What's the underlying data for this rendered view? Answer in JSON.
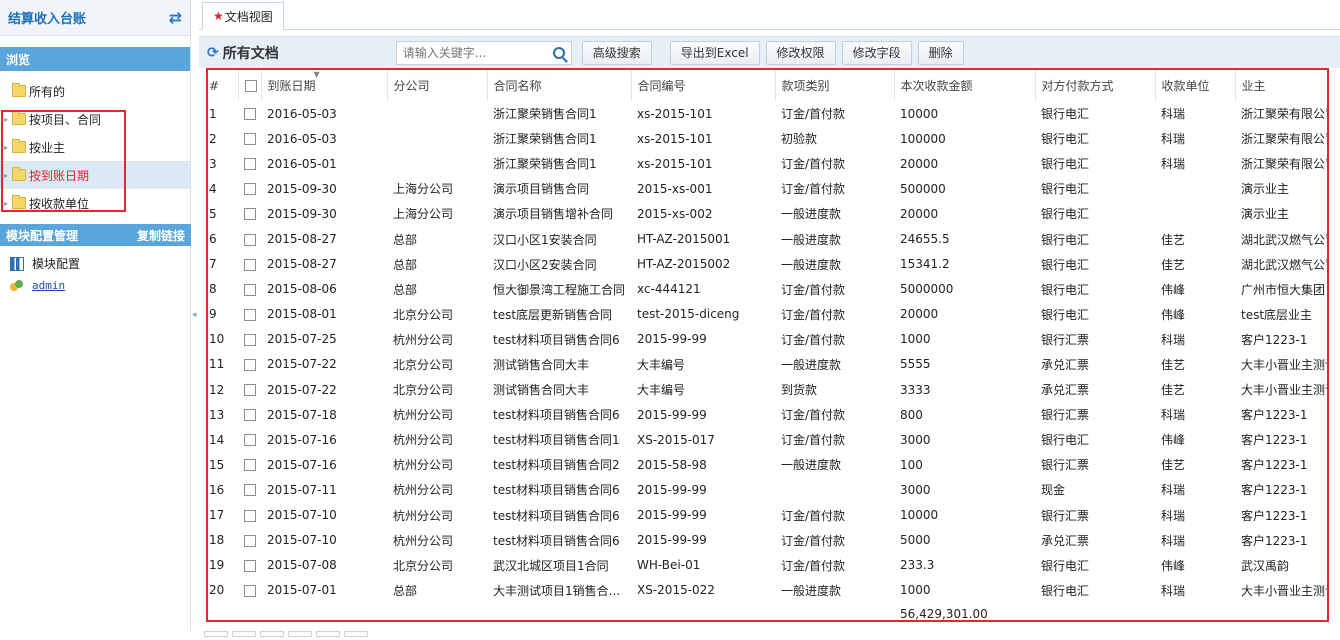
{
  "sidebar": {
    "title": "结算收入台账",
    "browse_label": "浏览",
    "tree": [
      {
        "label": "所有的",
        "caret": false
      },
      {
        "label": "按项目、合同",
        "caret": true
      },
      {
        "label": "按业主",
        "caret": true
      },
      {
        "label": "按到账日期",
        "caret": true,
        "selected": true
      },
      {
        "label": "按收款单位",
        "caret": true
      }
    ],
    "module_title": "模块配置管理",
    "copy_link": "复制链接",
    "module_config": "模块配置",
    "user": "admin"
  },
  "tab": {
    "star": "★",
    "label": "文档视图"
  },
  "toolbar": {
    "title": "所有文档",
    "search_placeholder": "请输入关键字...",
    "buttons": [
      "高级搜索",
      "导出到Excel",
      "修改权限",
      "修改字段",
      "删除"
    ]
  },
  "table": {
    "columns": [
      "#",
      "",
      "到账日期",
      "分公司",
      "合同名称",
      "合同编号",
      "款项类别",
      "本次收款金额",
      "对方付款方式",
      "收款单位",
      "业主"
    ],
    "rows": [
      [
        "1",
        "2016-05-03",
        "",
        "浙江聚荣销售合同1",
        "xs-2015-101",
        "订金/首付款",
        "10000",
        "银行电汇",
        "科瑞",
        "浙江聚荣有限公司"
      ],
      [
        "2",
        "2016-05-03",
        "",
        "浙江聚荣销售合同1",
        "xs-2015-101",
        "初验款",
        "100000",
        "银行电汇",
        "科瑞",
        "浙江聚荣有限公司"
      ],
      [
        "3",
        "2016-05-01",
        "",
        "浙江聚荣销售合同1",
        "xs-2015-101",
        "订金/首付款",
        "20000",
        "银行电汇",
        "科瑞",
        "浙江聚荣有限公司"
      ],
      [
        "4",
        "2015-09-30",
        "上海分公司",
        "演示项目销售合同",
        "2015-xs-001",
        "订金/首付款",
        "500000",
        "银行电汇",
        "",
        "演示业主"
      ],
      [
        "5",
        "2015-09-30",
        "上海分公司",
        "演示项目销售增补合同",
        "2015-xs-002",
        "一般进度款",
        "20000",
        "银行电汇",
        "",
        "演示业主"
      ],
      [
        "6",
        "2015-08-27",
        "总部",
        "汉口小区1安装合同",
        "HT-AZ-2015001",
        "一般进度款",
        "24655.5",
        "银行电汇",
        "佳艺",
        "湖北武汉燃气公司"
      ],
      [
        "7",
        "2015-08-27",
        "总部",
        "汉口小区2安装合同",
        "HT-AZ-2015002",
        "一般进度款",
        "15341.2",
        "银行电汇",
        "佳艺",
        "湖北武汉燃气公司"
      ],
      [
        "8",
        "2015-08-06",
        "总部",
        "恒大御景湾工程施工合同",
        "xc-444121",
        "订金/首付款",
        "5000000",
        "银行电汇",
        "伟峰",
        "广州市恒大集团"
      ],
      [
        "9",
        "2015-08-01",
        "北京分公司",
        "test底层更新销售合同",
        "test-2015-diceng",
        "订金/首付款",
        "20000",
        "银行电汇",
        "伟峰",
        "test底层业主"
      ],
      [
        "10",
        "2015-07-25",
        "杭州分公司",
        "test材料项目销售合同6",
        "2015-99-99",
        "订金/首付款",
        "1000",
        "银行汇票",
        "科瑞",
        "客户1223-1"
      ],
      [
        "11",
        "2015-07-22",
        "北京分公司",
        "测试销售合同大丰",
        "大丰编号",
        "一般进度款",
        "5555",
        "承兑汇票",
        "佳艺",
        "大丰小晋业主测试"
      ],
      [
        "12",
        "2015-07-22",
        "北京分公司",
        "测试销售合同大丰",
        "大丰编号",
        "到货款",
        "3333",
        "承兑汇票",
        "佳艺",
        "大丰小晋业主测试"
      ],
      [
        "13",
        "2015-07-18",
        "杭州分公司",
        "test材料项目销售合同6",
        "2015-99-99",
        "订金/首付款",
        "800",
        "银行汇票",
        "科瑞",
        "客户1223-1"
      ],
      [
        "14",
        "2015-07-16",
        "杭州分公司",
        "test材料项目销售合同1",
        "XS-2015-017",
        "订金/首付款",
        "3000",
        "银行电汇",
        "伟峰",
        "客户1223-1"
      ],
      [
        "15",
        "2015-07-16",
        "杭州分公司",
        "test材料项目销售合同2",
        "2015-58-98",
        "一般进度款",
        "100",
        "银行汇票",
        "佳艺",
        "客户1223-1"
      ],
      [
        "16",
        "2015-07-11",
        "杭州分公司",
        "test材料项目销售合同6",
        "2015-99-99",
        "",
        "3000",
        "现金",
        "科瑞",
        "客户1223-1"
      ],
      [
        "17",
        "2015-07-10",
        "杭州分公司",
        "test材料项目销售合同6",
        "2015-99-99",
        "订金/首付款",
        "10000",
        "银行汇票",
        "科瑞",
        "客户1223-1"
      ],
      [
        "18",
        "2015-07-10",
        "杭州分公司",
        "test材料项目销售合同6",
        "2015-99-99",
        "订金/首付款",
        "5000",
        "承兑汇票",
        "科瑞",
        "客户1223-1"
      ],
      [
        "19",
        "2015-07-08",
        "北京分公司",
        "武汉北城区项目1合同",
        "WH-Bei-01",
        "订金/首付款",
        "233.3",
        "银行电汇",
        "伟峰",
        "武汉禹韵"
      ],
      [
        "20",
        "2015-07-01",
        "总部",
        "大丰测试项目1销售合...",
        "XS-2015-022",
        "一般进度款",
        "1000",
        "银行电汇",
        "科瑞",
        "大丰小晋业主测试"
      ]
    ],
    "total": "56,429,301.00"
  }
}
